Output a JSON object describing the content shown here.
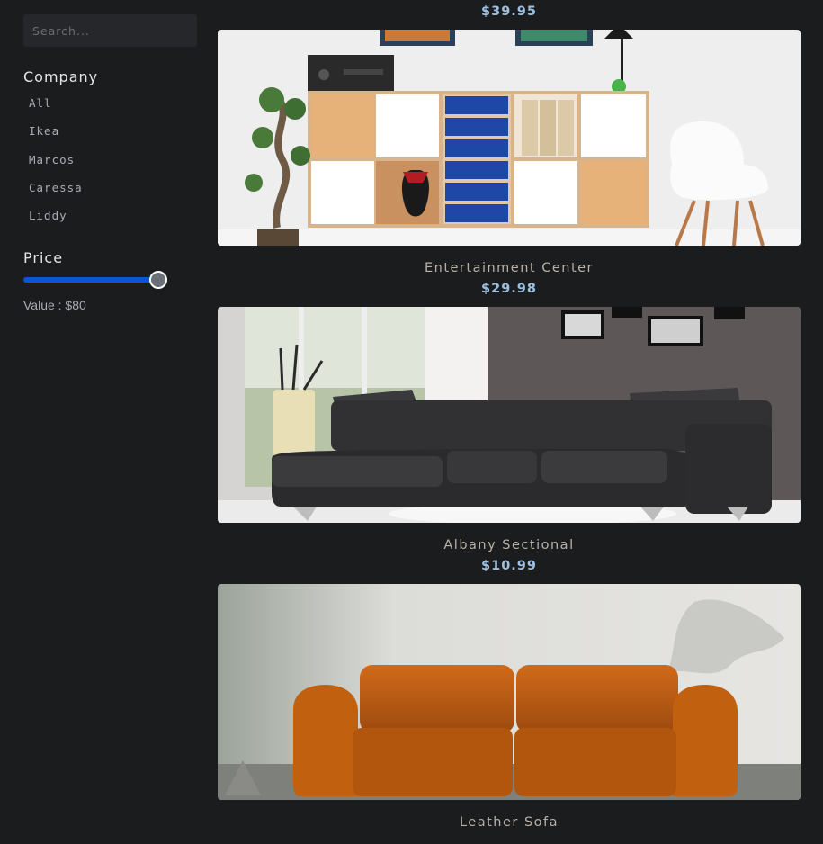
{
  "sidebar": {
    "search_placeholder": "Search...",
    "company_heading": "Company",
    "companies": [
      "All",
      "Ikea",
      "Marcos",
      "Caressa",
      "Liddy"
    ],
    "price_heading": "Price",
    "price_value_label": "Value : $80",
    "price_slider_level": 1.0
  },
  "products": [
    {
      "price": "$39.95",
      "image": "cabinet-shelf-photo"
    },
    {
      "name": "Entertainment Center",
      "price": "$29.98",
      "image": "sectional-sofa-photo"
    },
    {
      "name": "Albany Sectional",
      "price": "$10.99",
      "image": "leather-sofa-photo"
    },
    {
      "name": "Leather Sofa"
    }
  ],
  "colors": {
    "background": "#1b1c1e",
    "accent": "#0b55d6",
    "price": "#9ec0e0",
    "muted_text": "#a9adb3"
  }
}
